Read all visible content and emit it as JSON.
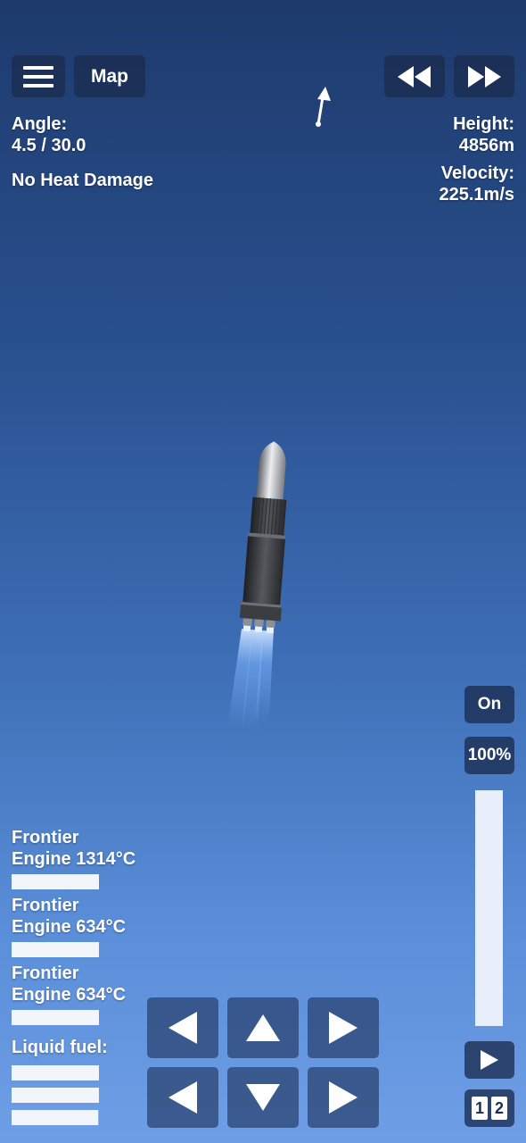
{
  "top_bar": {
    "menu_icon": "hamburger-menu-icon",
    "map_label": "Map",
    "rewind_icon": "rewind-icon",
    "fast_forward_icon": "fast-forward-icon",
    "direction_icon": "prograde-arrow-icon"
  },
  "telemetry": {
    "angle_label": "Angle:",
    "angle_value": "4.5 / 30.0",
    "heat_status": "No Heat Damage",
    "height_label": "Height:",
    "height_value": "4856m",
    "velocity_label": "Velocity:",
    "velocity_value": "225.1m/s"
  },
  "parts": [
    {
      "line1": "Frontier",
      "line2": "Engine 1314°C",
      "heat_level": 1.0
    },
    {
      "line1": "Frontier",
      "line2": "Engine 634°C",
      "heat_level": 1.0
    },
    {
      "line1": "Frontier",
      "line2": "Engine 634°C",
      "heat_level": 1.0
    }
  ],
  "fuel": {
    "label": "Liquid fuel:",
    "tank_levels": [
      1.0,
      1.0,
      0.99
    ]
  },
  "throttle": {
    "toggle_label": "On",
    "percent_label": "100%",
    "level": 1.0
  },
  "controls": {
    "rotate_left_icon": "arrow-left-icon",
    "throttle_up_icon": "arrow-up-icon",
    "rotate_right_icon": "arrow-right-icon",
    "move_left_icon": "arrow-left-icon",
    "throttle_down_icon": "arrow-down-icon",
    "move_right_icon": "arrow-right-icon",
    "stage_icon": "play-icon",
    "stage_numbers": [
      "1",
      "2"
    ]
  },
  "colors": {
    "sky_top": "#1e3a6c",
    "sky_bottom": "#6e9ee6",
    "button_bg": "#1b2d50",
    "flame": "#7fb6ff"
  }
}
